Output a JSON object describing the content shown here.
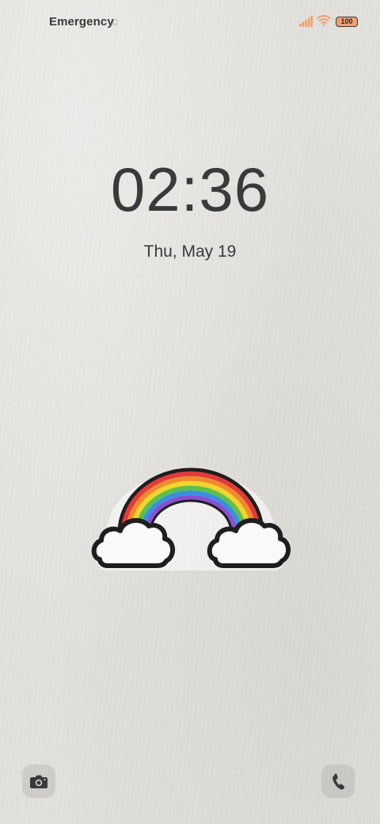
{
  "status_bar": {
    "carrier_text": "Emergency",
    "carrier_text_overflow": "c",
    "signal_icon": "cellular-signal-icon",
    "wifi_icon": "wifi-icon",
    "battery_level": "100",
    "accent_color": "#f0a070"
  },
  "lockscreen": {
    "time": "02:36",
    "date": "Thu, May 19"
  },
  "wallpaper": {
    "artwork": "rainbow-with-clouds",
    "background_color": "#e2e0dc"
  },
  "shortcuts": {
    "camera_icon": "camera-icon",
    "phone_icon": "phone-icon"
  }
}
